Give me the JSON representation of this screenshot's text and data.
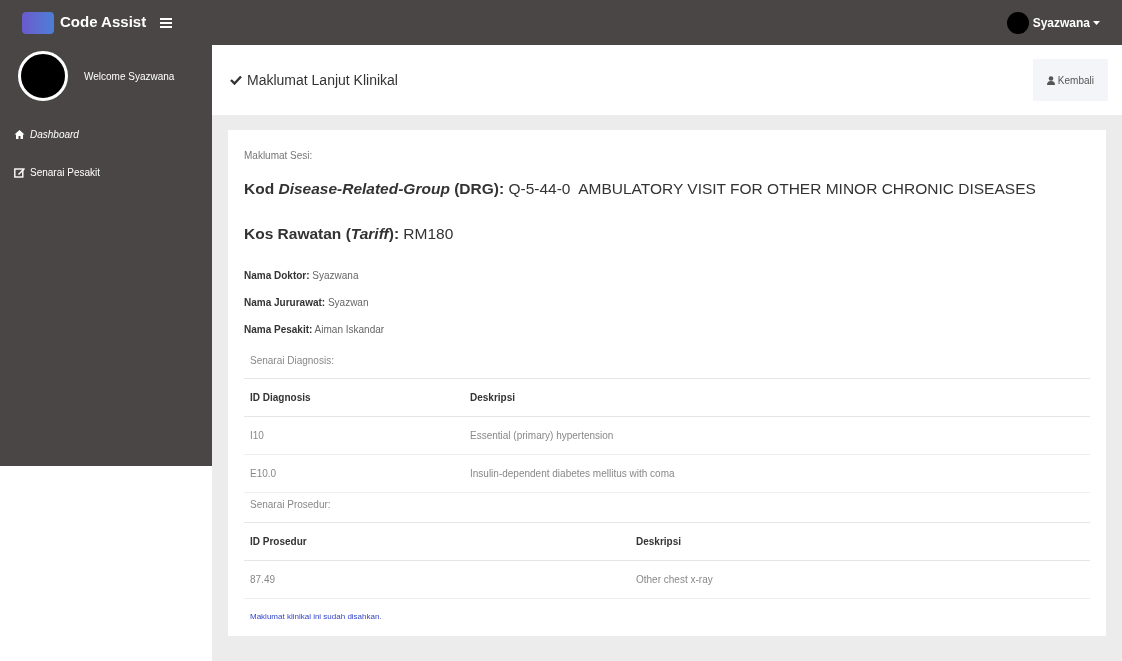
{
  "topbar": {
    "app_name": "Code Assist",
    "user": "Syazwana"
  },
  "sidebar": {
    "welcome": "Welcome Syazwana",
    "items": [
      {
        "label": "Dashboard",
        "kind": "home",
        "selected": true
      },
      {
        "label": "Senarai Pesakit",
        "kind": "edit",
        "selected": false
      }
    ]
  },
  "header": {
    "title": "Maklumat Lanjut Klinikal",
    "back_button": "Kembali"
  },
  "card": {
    "section_label": "Maklumat Sesi:",
    "headline": [
      {
        "label": "Kod *Disease-Related-Group* (DRG):",
        "value": "Q-5-44-0  AMBULATORY VISIT FOR OTHER MINOR CHRONIC DISEASES"
      },
      {
        "label": "Kos Rawatan (*Tariff*):",
        "value": "RM180"
      }
    ],
    "fields": [
      {
        "label": "Nama Doktor:",
        "value": "Syazwana"
      },
      {
        "label": "Nama Jururawat:",
        "value": "Syazwan"
      },
      {
        "label": "Nama Pesakit:",
        "value": "Aiman Iskandar"
      }
    ],
    "diagnosis": {
      "title": "Senarai Diagnosis:",
      "columns": [
        "ID Diagnosis",
        "Deskripsi"
      ],
      "rows": [
        [
          "I10",
          "Essential (primary) hypertension"
        ],
        [
          "E10.0",
          "Insulin-dependent diabetes mellitus with coma"
        ]
      ]
    },
    "procedures": {
      "title": "Senarai Prosedur:",
      "columns": [
        "ID Prosedur",
        "Deskripsi"
      ],
      "rows": [
        [
          "87.49",
          "Other chest x-ray"
        ]
      ]
    },
    "note": "Maklumat klinikal ini sudah disahkan."
  }
}
